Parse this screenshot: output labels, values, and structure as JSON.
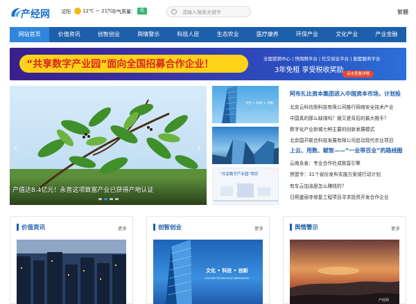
{
  "header": {
    "logo_text": "产经网",
    "city": "沈阳",
    "temperature": "12℃ ~ 21℃",
    "air_quality_label": "中气质量：",
    "air_quality_value": "优",
    "search_placeholder": "请输入搜索关键字",
    "traditional_label": "繁體"
  },
  "nav": {
    "items": [
      {
        "label": "网站首页",
        "active": true
      },
      {
        "label": "价值资讯",
        "active": false
      },
      {
        "label": "创智创业",
        "active": false
      },
      {
        "label": "舆情警示",
        "active": false
      },
      {
        "label": "科技人居",
        "active": false
      },
      {
        "label": "生态农业",
        "active": false
      },
      {
        "label": "医疗康养",
        "active": false
      },
      {
        "label": "环保产业",
        "active": false
      },
      {
        "label": "文化产业",
        "active": false
      },
      {
        "label": "产业金融",
        "active": false
      }
    ]
  },
  "banner": {
    "title": "“共享数字产业园”面向全国招募合作企业！",
    "sub": "全国营销中心 | 快雨税平台 | 社交创业平台 | 配套服务平台",
    "big": "3年免租  享受税收奖励",
    "button": "点击查看详情"
  },
  "slider": {
    "caption": "产值达8.4亿元！永善这项致富产业已获得产地认证",
    "prev_symbol": "‹",
    "next_symbol": "›",
    "dots": 4,
    "active_dot": 1
  },
  "thumbs": {
    "thumb1_text": "文化 + 科技 + 创新",
    "thumb3_title": "“共享数字产业园”项目"
  },
  "news": {
    "headline": "阿布扎比资本集团进入中国资本市场，计划投",
    "items": [
      "北京云科信刚科技有限公司推行网络安全技术产业",
      "中国真的那么缺煤吗？拨又是背后的最大推手？",
      "数字化产业新城七种主要的创新发展模式",
      "北京国开联合科技发展有限公司启动现代农业项目"
    ],
    "headline2": "上云、用数、赋智——“一业带百业”的路线图",
    "items2": [
      "云南永善：专业合作社成致富引擎",
      "禁盟令：31个省份发布实施方案或行动计划",
      "有车云加油是怎么赚钱的？",
      "日照盛丽寺修复工程项目寻求投资开发合作企业"
    ]
  },
  "sections": [
    {
      "title": "价值资讯",
      "more": "更多"
    },
    {
      "title": "创智创业",
      "more": "更多",
      "img_text": "文化 • 科技 • 创新",
      "img_sub": "CULTURE  TECHNOLOGY  INNOVATION"
    },
    {
      "title": "舆情警示",
      "more": "更多",
      "watermark": "产经网"
    }
  ],
  "colors": {
    "brand_blue": "#1d5fab",
    "nav_active": "#2f86dc",
    "banner_yellow": "#ffd21a",
    "banner_red": "#d8261c"
  }
}
